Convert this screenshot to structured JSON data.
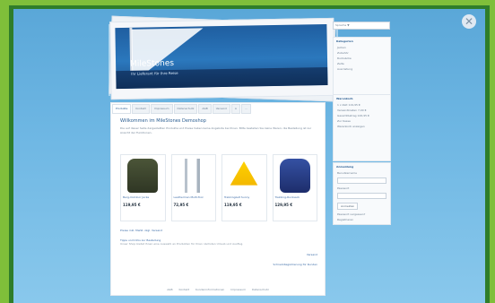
{
  "header": {
    "title": "MileStones",
    "subtitle": "Ihr Lieferant für Ihre Reise"
  },
  "language": {
    "value": "Sprache ▼"
  },
  "tabs": [
    "Produkte",
    "Kontakt",
    "Impressum",
    "Datenschutz",
    "AGB",
    "Versand",
    "A",
    "..."
  ],
  "content": {
    "heading": "Willkommen im MileStones Demoshop",
    "paragraph": "Die auf dieser Seite dargestellten Produkte und Preise haben keine Angebote bei Ihnen. Bitte bestellen Sie keine Waren; die Bestellung ist zur Ansicht der Funktionen."
  },
  "products": [
    {
      "name": "Berg-Outdoor Jacke",
      "price": "119,95 €"
    },
    {
      "name": "Leatherman Multi-Tool",
      "price": "72,95 €"
    },
    {
      "name": "Trekkingzelt Sunny",
      "price": "119,95 €"
    },
    {
      "name": "Trekking-Rucksack",
      "price": "129,95 €"
    }
  ],
  "links": {
    "note": "Preise inkl. MwSt. zzgl. Versand",
    "section": "Tipps und Infos zur Bestellung",
    "small_text": "Unser Shop bietet Ihnen eine Auswahl an Produkten für Ihren nächsten Urlaub und Ausflug.",
    "link1": "Versand",
    "link2": "Schnell-Registrierung für Kunden"
  },
  "footer": [
    "AGB",
    "Kontakt",
    "Kundeninformationen",
    "Impressum",
    "Datenschutz"
  ],
  "sidebar": {
    "categories_title": "Kategorien",
    "categories": [
      "Jacken",
      "Zubehör",
      "Rucksäcke",
      "Zelte",
      "Ausrüstung"
    ],
    "basket_title": "Warenkorb",
    "basket_lines": [
      "1 x Zelt 119,95 €",
      "Versandkosten 7,00 €",
      "Gesamtbetrag 126,95 €"
    ],
    "basket_buttons": [
      "Zur Kasse",
      "Warenkorb anzeigen"
    ],
    "login_title": "Anmeldung",
    "login_labels": [
      "Benutzername",
      "Passwort"
    ],
    "login_button": "Anmelden",
    "login_links": [
      "Passwort vergessen?",
      "Registrieren"
    ]
  }
}
